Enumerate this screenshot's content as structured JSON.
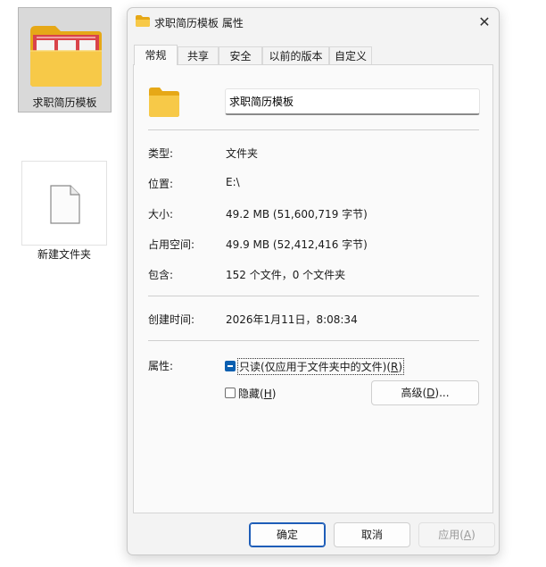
{
  "desktop": {
    "items": [
      {
        "label": "求职简历模板"
      },
      {
        "label": "新建文件夹"
      }
    ]
  },
  "dialog": {
    "title": "求职简历模板 属性",
    "close_glyph": "✕",
    "tabs": [
      {
        "label": "常规"
      },
      {
        "label": "共享"
      },
      {
        "label": "安全"
      },
      {
        "label": "以前的版本"
      },
      {
        "label": "自定义"
      }
    ],
    "active_tab": "常规",
    "name_value": "求职简历模板",
    "fields": {
      "type": {
        "label": "类型:",
        "value": "文件夹"
      },
      "location": {
        "label": "位置:",
        "value": "E:\\"
      },
      "size": {
        "label": "大小:",
        "value": "49.2 MB (51,600,719 字节)"
      },
      "size_on_disk": {
        "label": "占用空间:",
        "value": "49.9 MB (52,412,416 字节)"
      },
      "contains": {
        "label": "包含:",
        "value": "152 个文件，0 个文件夹"
      },
      "created": {
        "label": "创建时间:",
        "value": "2026年1月11日，8:08:34"
      }
    },
    "attributes": {
      "label": "属性:",
      "readonly": {
        "text": "只读(仅应用于文件夹中的文件)(",
        "key": "R",
        "tail": ")",
        "state": "indeterminate"
      },
      "hidden": {
        "text": "隐藏(",
        "key": "H",
        "tail": ")",
        "state": "unchecked"
      },
      "advanced": {
        "text": "高级(",
        "key": "D",
        "tail": ")..."
      }
    },
    "buttons": {
      "ok": "确定",
      "cancel": "取消",
      "apply_text": "应用(",
      "apply_key": "A",
      "apply_tail": ")"
    }
  },
  "colors": {
    "folder_yellow": "#f7c948",
    "folder_dark": "#e6a817",
    "accent": "#0a5fb0",
    "thumb_red": "#d9434a"
  }
}
